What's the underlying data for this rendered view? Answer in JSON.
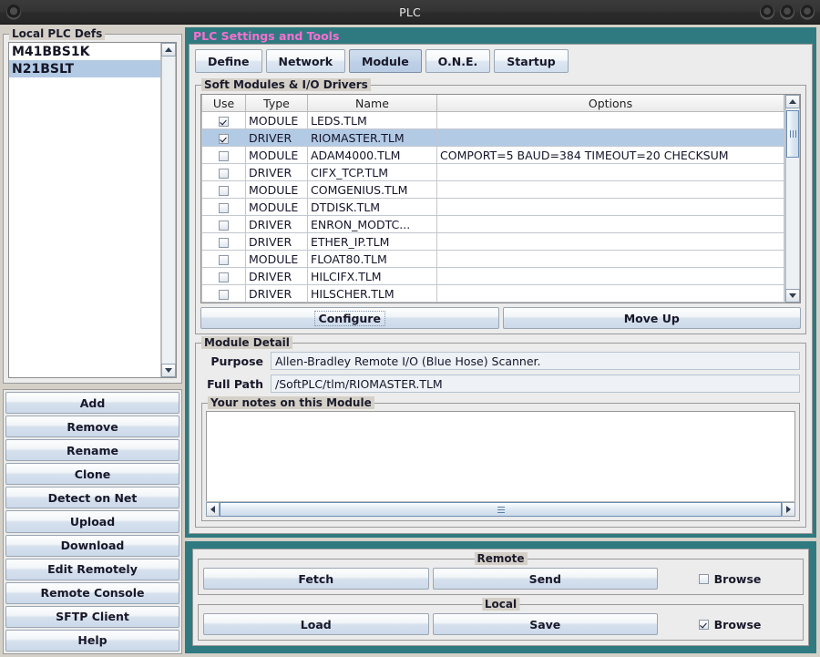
{
  "window": {
    "title": "PLC",
    "menu_icon": "app-menu-icon",
    "buttons": [
      "minimize-button",
      "maximize-button",
      "close-button"
    ]
  },
  "sidebar": {
    "group_title": "Local PLC Defs",
    "list": [
      {
        "label": "M41BBS1K",
        "selected": false
      },
      {
        "label": "N21BSLT",
        "selected": true
      }
    ],
    "buttons": [
      {
        "label": "Add"
      },
      {
        "label": "Remove"
      },
      {
        "label": "Rename"
      },
      {
        "label": "Clone"
      },
      {
        "label": "Detect on Net"
      },
      {
        "label": "Upload"
      },
      {
        "label": "Download"
      },
      {
        "label": "Edit Remotely"
      },
      {
        "label": "Remote Console"
      },
      {
        "label": "SFTP Client"
      },
      {
        "label": "Help"
      }
    ]
  },
  "settings": {
    "panel_title": "PLC Settings and Tools",
    "panel_title_color": "#f86fcf",
    "panel_border_color": "#2e7a80",
    "tabs": [
      {
        "label": "Define",
        "active": false
      },
      {
        "label": "Network",
        "active": false
      },
      {
        "label": "Module",
        "active": true
      },
      {
        "label": "O.N.E.",
        "active": false
      },
      {
        "label": "Startup",
        "active": false
      }
    ],
    "modules_group_title": "Soft Modules & I/O Drivers",
    "table": {
      "columns": [
        "Use",
        "Type",
        "Name",
        "Options"
      ],
      "rows": [
        {
          "use": true,
          "type": "MODULE",
          "name": "LEDS.TLM",
          "options": "",
          "selected": false
        },
        {
          "use": true,
          "type": "DRIVER",
          "name": "RIOMASTER.TLM",
          "options": "",
          "selected": true
        },
        {
          "use": false,
          "type": "MODULE",
          "name": "ADAM4000.TLM",
          "options": "COMPORT=5 BAUD=384 TIMEOUT=20 CHECKSUM",
          "selected": false
        },
        {
          "use": false,
          "type": "DRIVER",
          "name": "CIFX_TCP.TLM",
          "options": "",
          "selected": false
        },
        {
          "use": false,
          "type": "MODULE",
          "name": "COMGENIUS.TLM",
          "options": "",
          "selected": false
        },
        {
          "use": false,
          "type": "MODULE",
          "name": "DTDISK.TLM",
          "options": "",
          "selected": false
        },
        {
          "use": false,
          "type": "DRIVER",
          "name": "ENRON_MODTC...",
          "options": "",
          "selected": false
        },
        {
          "use": false,
          "type": "DRIVER",
          "name": "ETHER_IP.TLM",
          "options": "",
          "selected": false
        },
        {
          "use": false,
          "type": "MODULE",
          "name": "FLOAT80.TLM",
          "options": "",
          "selected": false
        },
        {
          "use": false,
          "type": "DRIVER",
          "name": "HILCIFX.TLM",
          "options": "",
          "selected": false
        },
        {
          "use": false,
          "type": "DRIVER",
          "name": "HILSCHER.TLM",
          "options": "",
          "selected": false
        }
      ]
    },
    "actions": {
      "configure_label": "Configure",
      "moveup_label": "Move Up"
    },
    "detail": {
      "group_title": "Module Detail",
      "purpose_label": "Purpose",
      "purpose_value": "Allen-Bradley Remote I/O (Blue Hose) Scanner.",
      "fullpath_label": "Full Path",
      "fullpath_value": "/SoftPLC/tlm/RIOMASTER.TLM",
      "notes_group_title": "Your notes on this Module",
      "notes_value": ""
    }
  },
  "transfer": {
    "remote": {
      "group_title": "Remote",
      "fetch_label": "Fetch",
      "send_label": "Send",
      "browse_label": "Browse",
      "browse_checked": false
    },
    "local": {
      "group_title": "Local",
      "load_label": "Load",
      "save_label": "Save",
      "browse_label": "Browse",
      "browse_checked": true
    }
  }
}
